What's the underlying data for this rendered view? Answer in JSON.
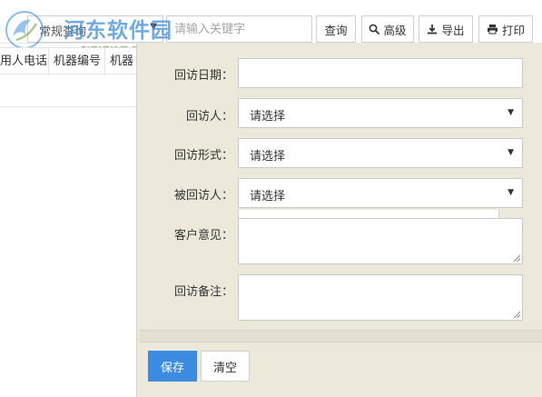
{
  "toolbar": {
    "query_type": "常规查询",
    "search_placeholder": "请输入关键字",
    "query_label": "查询",
    "advanced_label": "高级",
    "export_label": "导出",
    "print_label": "打印"
  },
  "watermark": {
    "title": "河东软件园",
    "url": "www.pc0359.cn"
  },
  "table": {
    "columns": [
      "用人电话",
      "机器编号",
      "机器"
    ]
  },
  "form": {
    "visit_date_label": "回访日期：",
    "visit_date_value": "",
    "visitor_label": "回访人：",
    "visitor_value": "请选择",
    "visit_method_label": "回访形式：",
    "visit_method_value": "请选择",
    "visited_person_label": "被回访人：",
    "visited_person_value": "请选择",
    "customer_opinion_label": "客户意见：",
    "customer_opinion_value": "",
    "remark_label": "回访备注：",
    "remark_value": "",
    "save_label": "保存",
    "clear_label": "清空"
  },
  "colors": {
    "primary_button": "#3b8be0",
    "panel_background": "#ece9db",
    "watermark_blue": "#3f8fd8",
    "watermark_green": "#6ea63b"
  },
  "icons": {
    "advanced": "search-icon",
    "export": "download-icon",
    "print": "print-icon"
  }
}
